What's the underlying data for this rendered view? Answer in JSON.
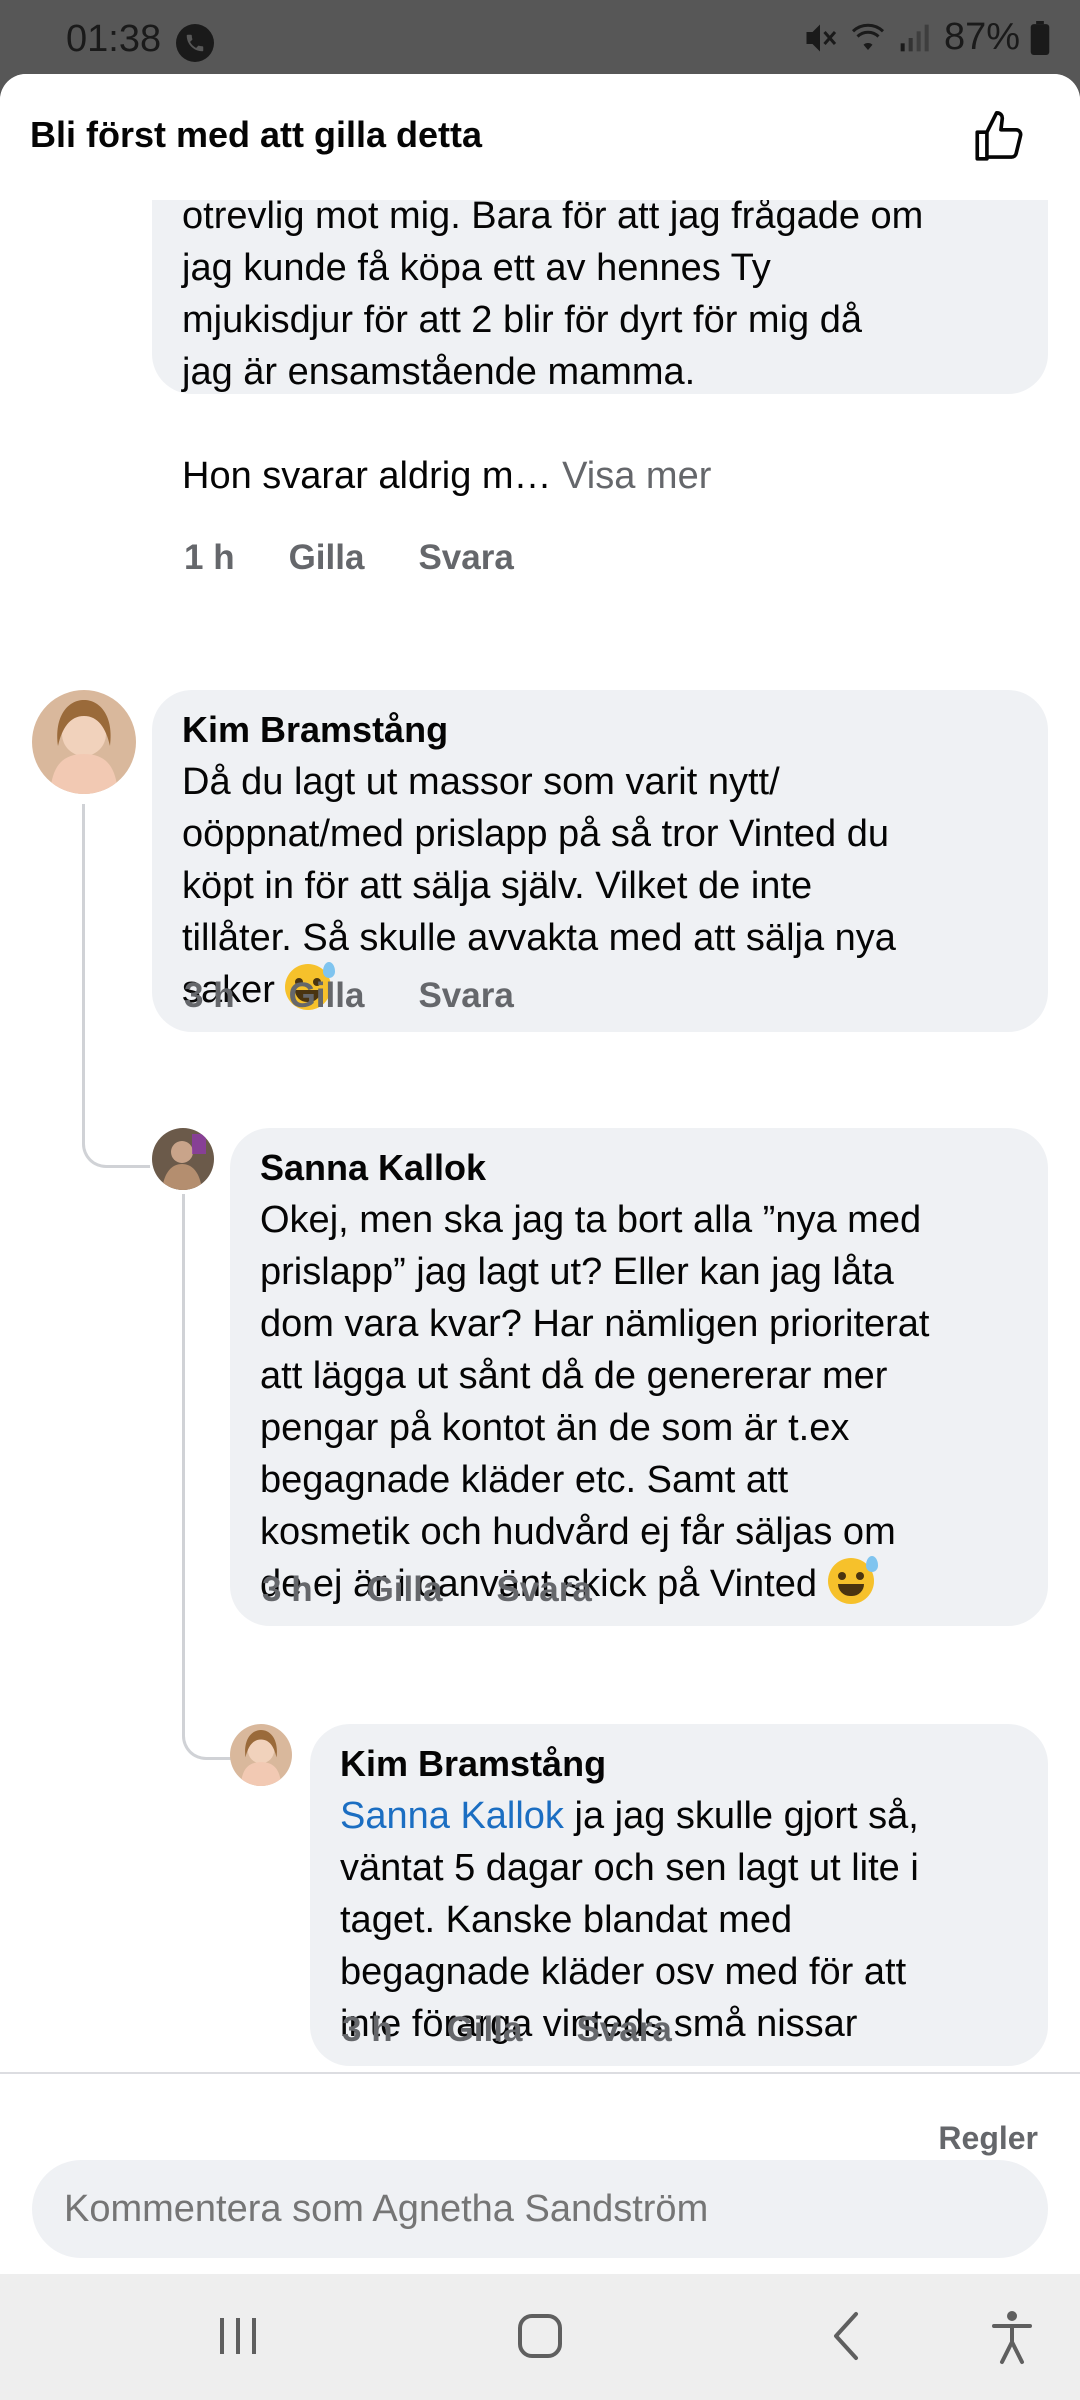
{
  "status_bar": {
    "time": "01:38",
    "battery": "87%",
    "icons": [
      "call-icon",
      "mute-icon",
      "wifi-icon",
      "signal-icon",
      "battery-icon"
    ]
  },
  "header": {
    "title": "Bli först med att gilla detta",
    "like_icon": "thumbs-up-icon"
  },
  "comments": [
    {
      "lines": [
        "otrevlig mot mig. Bara för att jag frågade om",
        "jag kunde få köpa ett av hennes Ty",
        "mjukisdjur för att 2 blir för dyrt för mig då",
        "jag är ensamstående mamma.",
        "",
        "Hon svarar aldrig m…"
      ],
      "more": "Visa mer",
      "time": "1 h",
      "like": "Gilla",
      "reply": "Svara"
    },
    {
      "author": "Kim Bramstång",
      "lines": [
        "Då du lagt ut massor som varit nytt/",
        "oöppnat/med prislapp på så tror Vinted du",
        "köpt in för att sälja själv. Vilket de inte",
        "tillåter. Så skulle avvakta med att sälja nya",
        "saker"
      ],
      "time": "3 h",
      "like": "Gilla",
      "reply": "Svara"
    },
    {
      "author": "Sanna Kallok",
      "lines": [
        "Okej, men ska jag ta bort alla ”nya med",
        "prislapp”  jag lagt ut? Eller kan jag låta",
        "dom vara kvar? Har nämligen prioriterat",
        "att lägga ut sånt då de genererar mer",
        "pengar på kontot än de som är t.ex",
        "begagnade kläder etc. Samt att",
        "kosmetik och hudvård ej får säljas om",
        "de ej är i oanvänt skick på Vinted"
      ],
      "time": "3 h",
      "like": "Gilla",
      "reply": "Svara"
    },
    {
      "author": "Kim Bramstång",
      "mention": "Sanna Kallok",
      "lines": [
        " ja jag skulle gjort så,",
        "väntat 5 dagar och sen lagt ut lite i",
        "taget. Kanske blandat med",
        "begagnade kläder osv med för att",
        "inte förarga vinteds små nissar"
      ],
      "time": "3 h",
      "like": "Gilla",
      "reply": "Svara"
    }
  ],
  "footer": {
    "rules": "Regler",
    "comment_placeholder": "Kommentera som Agnetha Sandström"
  },
  "colors": {
    "bubble": "#eff1f4",
    "mention": "#1b6ec2",
    "muted": "#65676b",
    "status_bar": "#575757"
  }
}
